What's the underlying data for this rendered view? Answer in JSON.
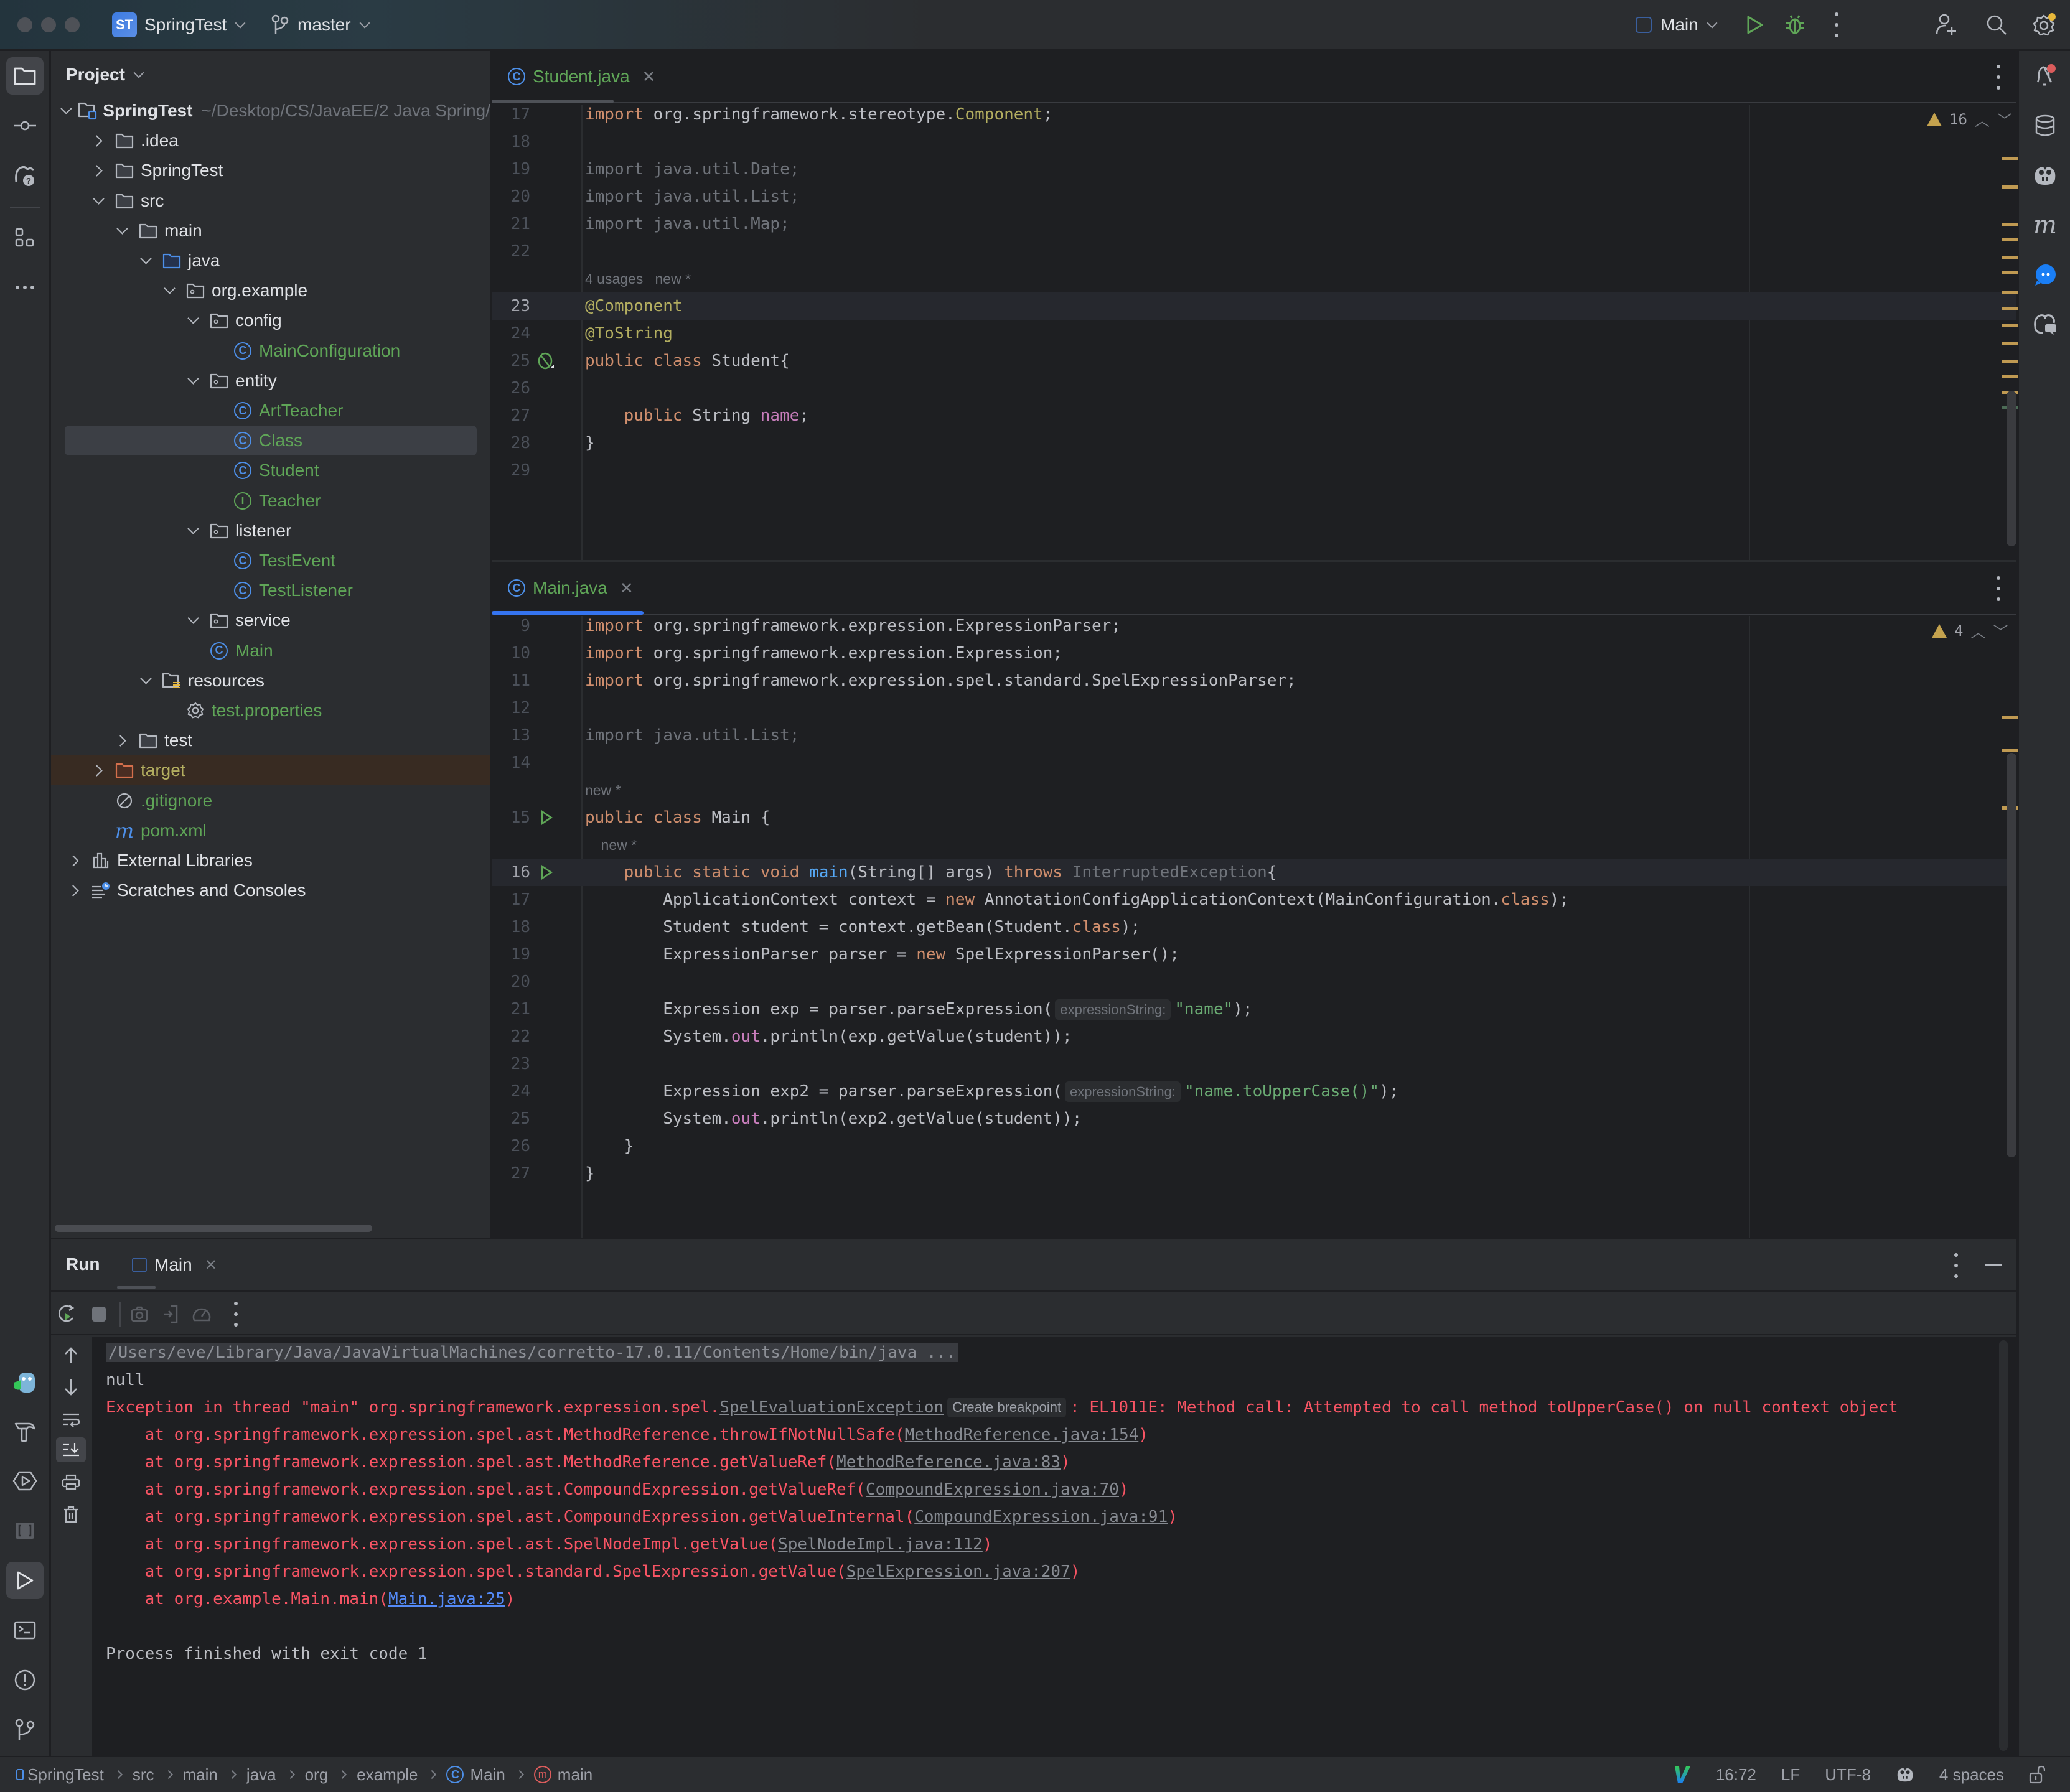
{
  "titlebar": {
    "project_badge": "ST",
    "project_name": "SpringTest",
    "branch": "master",
    "run_config": "Main"
  },
  "project_panel": {
    "title": "Project",
    "tree": [
      {
        "label": "SpringTest",
        "suffix": "~/Desktop/CS/JavaEE/2 Java Spring/",
        "depth": 0,
        "arrow": "down",
        "icon": "module-folder",
        "style": "bold"
      },
      {
        "label": ".idea",
        "depth": 1,
        "arrow": "right",
        "icon": "folder",
        "style": "norm"
      },
      {
        "label": "SpringTest",
        "depth": 1,
        "arrow": "right",
        "icon": "folder",
        "style": "norm"
      },
      {
        "label": "src",
        "depth": 1,
        "arrow": "down",
        "icon": "folder",
        "style": "norm"
      },
      {
        "label": "main",
        "depth": 2,
        "arrow": "down",
        "icon": "folder",
        "style": "norm"
      },
      {
        "label": "java",
        "depth": 3,
        "arrow": "down",
        "icon": "source-folder",
        "style": "norm"
      },
      {
        "label": "org.example",
        "depth": 4,
        "arrow": "down",
        "icon": "package",
        "style": "norm"
      },
      {
        "label": "config",
        "depth": 5,
        "arrow": "down",
        "icon": "package",
        "style": "norm"
      },
      {
        "label": "MainConfiguration",
        "depth": 6,
        "arrow": "",
        "icon": "class",
        "style": "green"
      },
      {
        "label": "entity",
        "depth": 5,
        "arrow": "down",
        "icon": "package",
        "style": "norm"
      },
      {
        "label": "ArtTeacher",
        "depth": 6,
        "arrow": "",
        "icon": "class",
        "style": "green"
      },
      {
        "label": "Class",
        "depth": 6,
        "arrow": "",
        "icon": "class",
        "style": "green",
        "selected": true
      },
      {
        "label": "Student",
        "depth": 6,
        "arrow": "",
        "icon": "class",
        "style": "green"
      },
      {
        "label": "Teacher",
        "depth": 6,
        "arrow": "",
        "icon": "interface",
        "style": "green"
      },
      {
        "label": "listener",
        "depth": 5,
        "arrow": "down",
        "icon": "package",
        "style": "norm"
      },
      {
        "label": "TestEvent",
        "depth": 6,
        "arrow": "",
        "icon": "class",
        "style": "green"
      },
      {
        "label": "TestListener",
        "depth": 6,
        "arrow": "",
        "icon": "class",
        "style": "green"
      },
      {
        "label": "service",
        "depth": 5,
        "arrow": "down",
        "icon": "package",
        "style": "norm"
      },
      {
        "label": "Main",
        "depth": 5,
        "arrow": "",
        "icon": "class",
        "style": "green"
      },
      {
        "label": "resources",
        "depth": 3,
        "arrow": "down",
        "icon": "resources-folder",
        "style": "norm"
      },
      {
        "label": "test.properties",
        "depth": 4,
        "arrow": "",
        "icon": "properties",
        "style": "green"
      },
      {
        "label": "test",
        "depth": 2,
        "arrow": "right",
        "icon": "folder",
        "style": "norm"
      },
      {
        "label": "target",
        "depth": 1,
        "arrow": "right",
        "icon": "excluded-folder",
        "style": "olive",
        "excluded": true
      },
      {
        "label": ".gitignore",
        "depth": 1,
        "arrow": "",
        "icon": "ignore",
        "style": "green"
      },
      {
        "label": "pom.xml",
        "depth": 1,
        "arrow": "",
        "icon": "maven",
        "style": "green"
      },
      {
        "label": "External Libraries",
        "depth": 0,
        "arrow": "right",
        "icon": "libraries",
        "style": "norm"
      },
      {
        "label": "Scratches and Consoles",
        "depth": 0,
        "arrow": "right",
        "icon": "scratches",
        "style": "norm"
      }
    ]
  },
  "editor_top": {
    "tab_label": "Student.java",
    "warnings": "16",
    "lines": [
      {
        "n": "17",
        "tokens": [
          [
            "kw",
            "import"
          ],
          [
            "",
            " org.springframework.stereotype."
          ],
          [
            "ann",
            "Component"
          ],
          [
            "",
            ";"
          ]
        ]
      },
      {
        "n": "18",
        "tokens": []
      },
      {
        "n": "19",
        "tokens": [
          [
            "unused",
            "import java.util.Date;"
          ]
        ]
      },
      {
        "n": "20",
        "tokens": [
          [
            "unused",
            "import java.util.List;"
          ]
        ]
      },
      {
        "n": "21",
        "tokens": [
          [
            "unused",
            "import java.util.Map;"
          ]
        ]
      },
      {
        "n": "22",
        "tokens": []
      },
      {
        "n": "",
        "lens": "4 usages   new *"
      },
      {
        "n": "23",
        "current": true,
        "tokens": [
          [
            "ann",
            "@Component"
          ]
        ]
      },
      {
        "n": "24",
        "tokens": [
          [
            "ann",
            "@ToString"
          ]
        ]
      },
      {
        "n": "25",
        "tokens": [
          [
            "kw",
            "public class "
          ],
          [
            "",
            "Student{"
          ]
        ],
        "gutter": "bean"
      },
      {
        "n": "26",
        "tokens": []
      },
      {
        "n": "27",
        "tokens": [
          [
            "",
            "    "
          ],
          [
            "kw",
            "public "
          ],
          [
            "",
            "String "
          ],
          [
            "fld",
            "name"
          ],
          [
            "",
            ";"
          ]
        ]
      },
      {
        "n": "28",
        "tokens": [
          [
            "",
            "}"
          ]
        ]
      },
      {
        "n": "29",
        "tokens": []
      }
    ]
  },
  "editor_bottom": {
    "tab_label": "Main.java",
    "warnings": "4",
    "lines": [
      {
        "n": "9",
        "tokens": [
          [
            "kw",
            "import"
          ],
          [
            "",
            " org.springframework.expression.ExpressionParser;"
          ]
        ]
      },
      {
        "n": "10",
        "tokens": [
          [
            "kw",
            "import"
          ],
          [
            "",
            " org.springframework.expression.Expression;"
          ]
        ]
      },
      {
        "n": "11",
        "tokens": [
          [
            "kw",
            "import"
          ],
          [
            "",
            " org.springframework.expression.spel.standard.SpelExpressionParser;"
          ]
        ]
      },
      {
        "n": "12",
        "tokens": []
      },
      {
        "n": "13",
        "tokens": [
          [
            "unused",
            "import java.util.List;"
          ]
        ]
      },
      {
        "n": "14",
        "tokens": []
      },
      {
        "n": "",
        "lens": "new *"
      },
      {
        "n": "15",
        "tokens": [
          [
            "kw",
            "public class "
          ],
          [
            "",
            "Main {"
          ]
        ],
        "gutter": "run"
      },
      {
        "n": "",
        "lens": "    new *"
      },
      {
        "n": "16",
        "current": true,
        "tokens": [
          [
            "",
            "    "
          ],
          [
            "kw",
            "public static void "
          ],
          [
            "fn",
            "main"
          ],
          [
            "",
            "(String[] args) "
          ],
          [
            "kw",
            "throws "
          ],
          [
            "unused",
            "InterruptedException"
          ],
          [
            "",
            "{"
          ]
        ],
        "gutter": "run"
      },
      {
        "n": "17",
        "tokens": [
          [
            "",
            "        ApplicationContext context = "
          ],
          [
            "kw",
            "new "
          ],
          [
            "",
            "AnnotationConfigApplicationContext(MainConfiguration."
          ],
          [
            "kw",
            "class"
          ],
          [
            "",
            ");"
          ]
        ]
      },
      {
        "n": "18",
        "tokens": [
          [
            "",
            "        Student student = context.getBean(Student."
          ],
          [
            "kw",
            "class"
          ],
          [
            "",
            ");"
          ]
        ]
      },
      {
        "n": "19",
        "tokens": [
          [
            "",
            "        ExpressionParser parser = "
          ],
          [
            "kw",
            "new "
          ],
          [
            "",
            "SpelExpressionParser();"
          ]
        ]
      },
      {
        "n": "20",
        "tokens": []
      },
      {
        "n": "21",
        "tokens": [
          [
            "",
            "        Expression exp = parser.parseExpression("
          ],
          [
            "hint",
            "expressionString:"
          ],
          [
            "str",
            "\"name\""
          ],
          [
            "",
            ");"
          ]
        ]
      },
      {
        "n": "22",
        "tokens": [
          [
            "",
            "        System."
          ],
          [
            "fld",
            "out"
          ],
          [
            "",
            ".println(exp.getValue(student));"
          ]
        ]
      },
      {
        "n": "23",
        "tokens": []
      },
      {
        "n": "24",
        "tokens": [
          [
            "",
            "        Expression exp2 = parser.parseExpression("
          ],
          [
            "hint",
            "expressionString:"
          ],
          [
            "str",
            "\"name.toUpperCase()\""
          ],
          [
            "",
            ");"
          ]
        ]
      },
      {
        "n": "25",
        "tokens": [
          [
            "",
            "        System."
          ],
          [
            "fld",
            "out"
          ],
          [
            "",
            ".println(exp2.getValue(student));"
          ]
        ]
      },
      {
        "n": "26",
        "tokens": [
          [
            "",
            "    }"
          ]
        ]
      },
      {
        "n": "27",
        "tokens": [
          [
            "",
            "}"
          ]
        ]
      }
    ]
  },
  "run_panel": {
    "title": "Run",
    "tab_label": "Main",
    "console": [
      {
        "type": "cmd",
        "parts": [
          [
            "cmd",
            "/Users/eve/Library/Java/JavaVirtualMachines/corretto-17.0.11/Contents/Home/bin/java ..."
          ]
        ]
      },
      {
        "type": "out",
        "parts": [
          [
            "out",
            "null"
          ]
        ]
      },
      {
        "type": "err",
        "parts": [
          [
            "err",
            "Exception in thread \"main\" org.springframework.expression.spel."
          ],
          [
            "link",
            "SpelEvaluationException"
          ],
          [
            "hint",
            "Create breakpoint"
          ],
          [
            "err",
            ": EL1011E: Method call: Attempted to call method toUpperCase() on null context object"
          ]
        ]
      },
      {
        "type": "err",
        "parts": [
          [
            "err",
            "    at org.springframework.expression.spel.ast.MethodReference.throwIfNotNullSafe("
          ],
          [
            "link",
            "MethodReference.java:154"
          ],
          [
            "err",
            ")"
          ]
        ]
      },
      {
        "type": "err",
        "parts": [
          [
            "err",
            "    at org.springframework.expression.spel.ast.MethodReference.getValueRef("
          ],
          [
            "link",
            "MethodReference.java:83"
          ],
          [
            "err",
            ")"
          ]
        ]
      },
      {
        "type": "err",
        "parts": [
          [
            "err",
            "    at org.springframework.expression.spel.ast.CompoundExpression.getValueRef("
          ],
          [
            "link",
            "CompoundExpression.java:70"
          ],
          [
            "err",
            ")"
          ]
        ]
      },
      {
        "type": "err",
        "parts": [
          [
            "err",
            "    at org.springframework.expression.spel.ast.CompoundExpression.getValueInternal("
          ],
          [
            "link",
            "CompoundExpression.java:91"
          ],
          [
            "err",
            ")"
          ]
        ]
      },
      {
        "type": "err",
        "parts": [
          [
            "err",
            "    at org.springframework.expression.spel.ast.SpelNodeImpl.getValue("
          ],
          [
            "link",
            "SpelNodeImpl.java:112"
          ],
          [
            "err",
            ")"
          ]
        ]
      },
      {
        "type": "err",
        "parts": [
          [
            "err",
            "    at org.springframework.expression.spel.standard.SpelExpression.getValue("
          ],
          [
            "link",
            "SpelExpression.java:207"
          ],
          [
            "err",
            ")"
          ]
        ]
      },
      {
        "type": "err",
        "parts": [
          [
            "err",
            "    at org.example.Main.main("
          ],
          [
            "linkblue",
            "Main.java:25"
          ],
          [
            "err",
            ")"
          ]
        ]
      },
      {
        "type": "blank",
        "parts": []
      },
      {
        "type": "out",
        "parts": [
          [
            "out",
            "Process finished with exit code 1"
          ]
        ]
      }
    ]
  },
  "statusbar": {
    "breadcrumbs": [
      "SpringTest",
      "src",
      "main",
      "java",
      "org",
      "example",
      "Main",
      "main"
    ],
    "caret": "16:72",
    "line_sep": "LF",
    "encoding": "UTF-8",
    "indent": "4 spaces"
  },
  "colors": {
    "accent": "#3574f0",
    "run_green": "#5fa557",
    "error_red": "#f75464",
    "warning": "#c4a24e"
  }
}
